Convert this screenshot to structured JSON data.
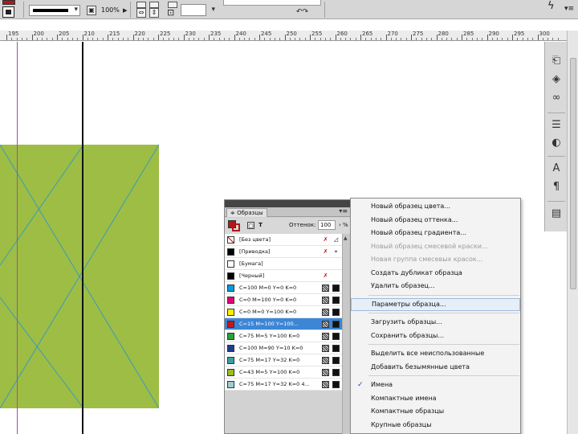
{
  "topbar": {
    "opacity": "100%",
    "colors": {
      "fill": "#b01818",
      "bar": "#d6d6d6"
    }
  },
  "ruler": {
    "labels": [
      "195",
      "200",
      "205",
      "210",
      "215",
      "220",
      "225",
      "230",
      "235",
      "240",
      "245",
      "250",
      "255",
      "260",
      "265",
      "270",
      "275",
      "280",
      "285",
      "290",
      "295",
      "300"
    ]
  },
  "canvas": {
    "frame_color": "#9dbd45",
    "guide_color": "#9b4fb0"
  },
  "swatches_panel": {
    "tab_label": "≑ Образцы",
    "tint_label": "Оттенок:",
    "tint_value": "100",
    "tint_unit": "%",
    "items": [
      {
        "name": "[Без цвета]",
        "color": "none",
        "icon1": "✗",
        "icon2": "◿"
      },
      {
        "name": "[Приводка]",
        "color": "#000000",
        "icon1": "✗",
        "icon2": "⌖"
      },
      {
        "name": "[Бумага]",
        "color": "#ffffff",
        "icon1": "",
        "icon2": ""
      },
      {
        "name": "[Черный]",
        "color": "#000000",
        "icon1": "✗",
        "icon2": ""
      },
      {
        "name": "C=100 M=0 Y=0 K=0",
        "color": "#009ee0",
        "icon1": "",
        "icon2": ""
      },
      {
        "name": "C=0 M=100 Y=0 K=0",
        "color": "#e2007a",
        "icon1": "",
        "icon2": ""
      },
      {
        "name": "C=0 M=0 Y=100 K=0",
        "color": "#ffed00",
        "icon1": "",
        "icon2": ""
      },
      {
        "name": "C=15 M=100 Y=100...",
        "color": "#c4161c",
        "icon1": "",
        "icon2": "",
        "selected": true
      },
      {
        "name": "C=75 M=5 Y=100 K=0",
        "color": "#2aa23c",
        "icon1": "",
        "icon2": ""
      },
      {
        "name": "C=100 M=90 Y=10 K=0",
        "color": "#1d3d8f",
        "icon1": "",
        "icon2": ""
      },
      {
        "name": "C=75 M=17 Y=32 K=0",
        "color": "#3e9ca3",
        "icon1": "",
        "icon2": ""
      },
      {
        "name": "C=43 M=5 Y=100 K=0",
        "color": "#9bbb2a",
        "icon1": "",
        "icon2": ""
      },
      {
        "name": "C=75 M=17 Y=32 K=0 4...",
        "color": "#9fcdd0",
        "icon1": "",
        "icon2": ""
      }
    ]
  },
  "context_menu": {
    "items": [
      {
        "label": "Новый образец цвета...",
        "state": "normal"
      },
      {
        "label": "Новый образец оттенка...",
        "state": "normal"
      },
      {
        "label": "Новый образец градиента...",
        "state": "normal"
      },
      {
        "label": "Новый образец смесевой краски...",
        "state": "disabled"
      },
      {
        "label": "Новая группа смесевых красок...",
        "state": "disabled"
      },
      {
        "label": "Создать дубликат образца",
        "state": "normal"
      },
      {
        "label": "Удалить образец...",
        "state": "normal"
      },
      {
        "label": "Параметры образца...",
        "state": "highlighted"
      },
      {
        "label": "Загрузить образцы...",
        "state": "normal"
      },
      {
        "label": "Сохранить образцы...",
        "state": "normal"
      },
      {
        "label": "Выделить все неиспользованные",
        "state": "normal"
      },
      {
        "label": "Добавить безымянные цвета",
        "state": "normal"
      },
      {
        "label": "Имена",
        "state": "checked"
      },
      {
        "label": "Компактные имена",
        "state": "normal"
      },
      {
        "label": "Компактные образцы",
        "state": "normal"
      },
      {
        "label": "Крупные образцы",
        "state": "normal"
      }
    ]
  }
}
